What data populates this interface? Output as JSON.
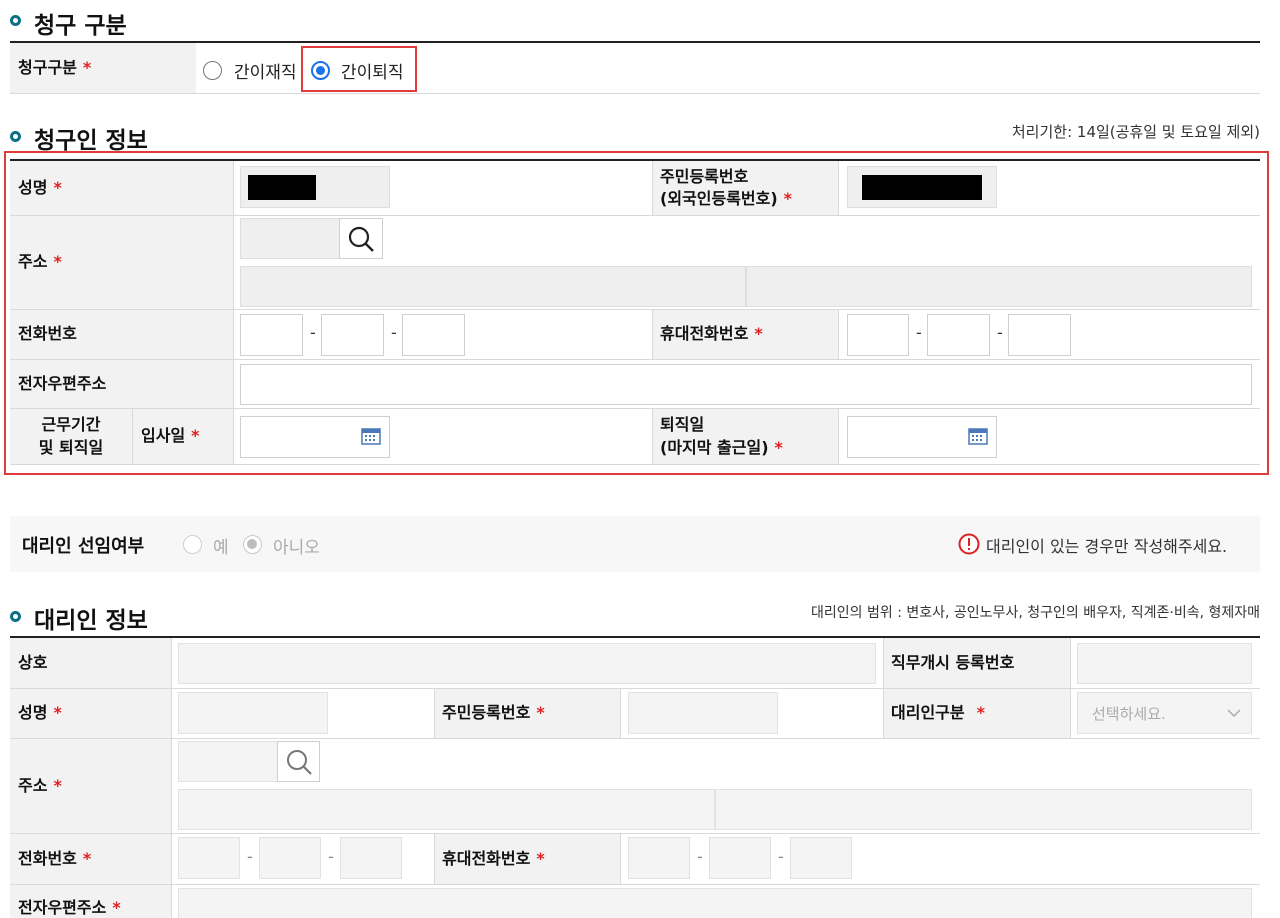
{
  "section_claim_type": {
    "title": "청구 구분",
    "label": "청구구분",
    "options": [
      {
        "label": "간이재직",
        "selected": false
      },
      {
        "label": "간이퇴직",
        "selected": true
      }
    ]
  },
  "section_claimant": {
    "title": "청구인 정보",
    "note": "처리기한: 14일(공휴일 및 토요일 제외)",
    "name_label": "성명",
    "rrn_label_1": "주민등록번호",
    "rrn_label_2": "(외국인등록번호)",
    "address_label": "주소",
    "phone_label": "전화번호",
    "mobile_label": "휴대전화번호",
    "email_label": "전자우편주소",
    "period_label_1": "근무기간",
    "period_label_2": "및 퇴직일",
    "join_label": "입사일",
    "leave_label_1": "퇴직일",
    "leave_label_2": "(마지막 출근일)",
    "dash": "-"
  },
  "agent_select": {
    "label": "대리인 선임여부",
    "options": [
      {
        "label": "예",
        "selected": false
      },
      {
        "label": "아니오",
        "selected": true
      }
    ],
    "notice": "대리인이 있는 경우만 작성해주세요."
  },
  "section_agent": {
    "title": "대리인 정보",
    "note": "대리인의 범위 : 변호사, 공인노무사, 청구인의 배우자, 직계존·비속, 형제자매",
    "company_label": "상호",
    "reg_no_label": "직무개시 등록번호",
    "name_label": "성명",
    "rrn_label": "주민등록번호",
    "type_label": "대리인구분",
    "type_placeholder": "선택하세요.",
    "address_label": "주소",
    "phone_label": "전화번호",
    "mobile_label": "휴대전화번호",
    "email_label": "전자우편주소",
    "dash": "-"
  },
  "colors": {
    "accent": "#0d6f87",
    "required": "#e02020",
    "highlight": "#e03c3c",
    "radio_selected": "#1a73e8",
    "header_bg": "#f2f2f2"
  }
}
